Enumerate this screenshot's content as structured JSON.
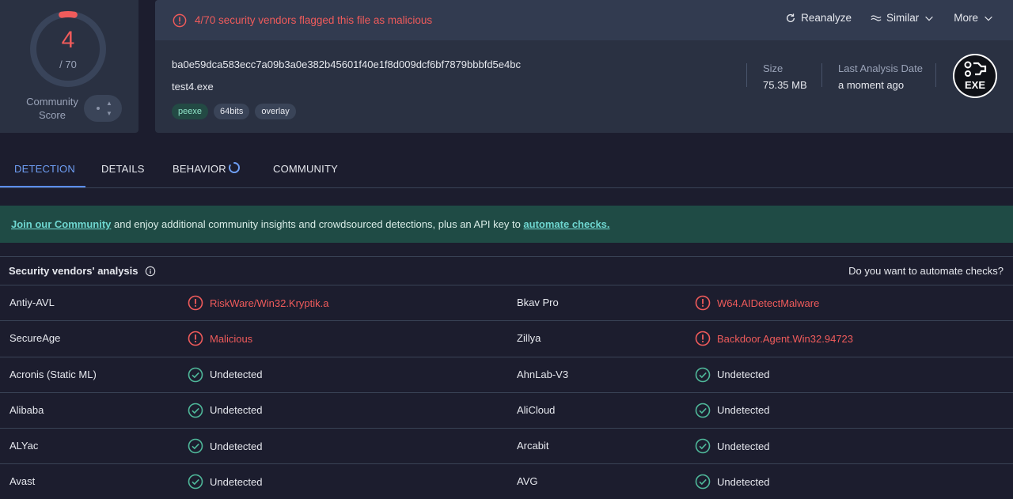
{
  "score": {
    "detections": "4",
    "total": "/ 70",
    "fraction": 0.0571,
    "community_label": "Community Score",
    "ring_color": "#f05b5b"
  },
  "summary": {
    "alert": "4/70 security vendors flagged this file as malicious",
    "actions": [
      {
        "label": "Reanalyze",
        "icon": "refresh-icon"
      },
      {
        "label": "Similar",
        "icon": "similar-icon"
      },
      {
        "label": "More",
        "icon": "chevron-down-icon"
      }
    ],
    "hash": "ba0e59dca583ecc7a09b3a0e382b45601f40e1f8d009dcf6bf7879bbbfd5e4bc",
    "filename": "test4.exe",
    "tags": [
      "peexe",
      "64bits",
      "overlay"
    ],
    "size_label": "Size",
    "size_value": "75.35 MB",
    "date_label": "Last Analysis Date",
    "date_value": "a moment ago",
    "file_type": "EXE"
  },
  "tabs": [
    "DETECTION",
    "DETAILS",
    "BEHAVIOR",
    "COMMUNITY"
  ],
  "banner": {
    "link1": "Join our Community",
    "middle": " and enjoy additional community insights and crowdsourced detections, plus an API key to ",
    "link2": "automate checks."
  },
  "analysis": {
    "title": "Security vendors' analysis",
    "automate_question": "Do you want to automate checks?",
    "rows": [
      {
        "v1": "Antiy-AVL",
        "r1": "RiskWare/Win32.Kryptik.a",
        "s1": "malicious",
        "v2": "Bkav Pro",
        "r2": "W64.AIDetectMalware",
        "s2": "malicious"
      },
      {
        "v1": "SecureAge",
        "r1": "Malicious",
        "s1": "malicious",
        "v2": "Zillya",
        "r2": "Backdoor.Agent.Win32.94723",
        "s2": "malicious"
      },
      {
        "v1": "Acronis (Static ML)",
        "r1": "Undetected",
        "s1": "ok",
        "v2": "AhnLab-V3",
        "r2": "Undetected",
        "s2": "ok"
      },
      {
        "v1": "Alibaba",
        "r1": "Undetected",
        "s1": "ok",
        "v2": "AliCloud",
        "r2": "Undetected",
        "s2": "ok"
      },
      {
        "v1": "ALYac",
        "r1": "Undetected",
        "s1": "ok",
        "v2": "Arcabit",
        "r2": "Undetected",
        "s2": "ok"
      },
      {
        "v1": "Avast",
        "r1": "Undetected",
        "s1": "ok",
        "v2": "AVG",
        "r2": "Undetected",
        "s2": "ok"
      }
    ]
  },
  "colors": {
    "malicious": "#f05b5b",
    "ok": "#4fb89a",
    "accent": "#5b8def"
  }
}
